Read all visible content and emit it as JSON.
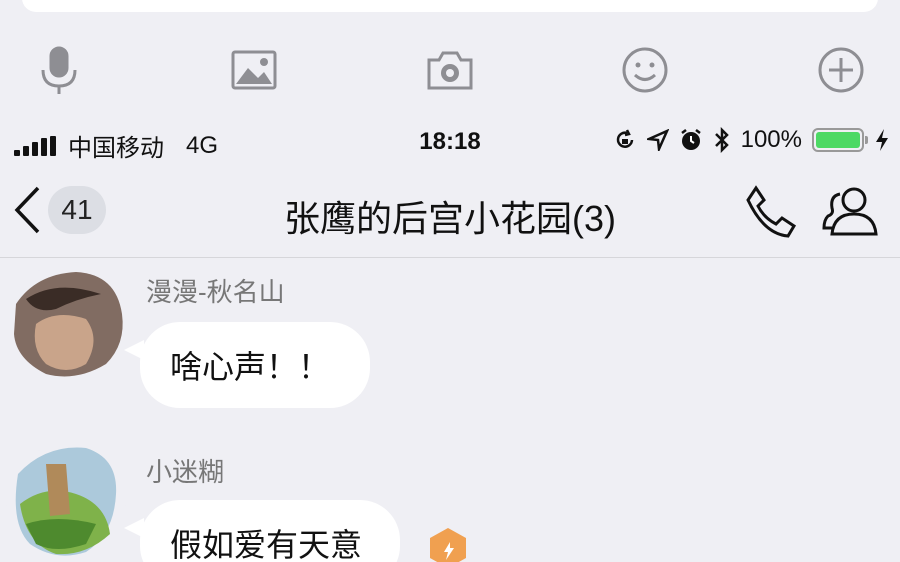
{
  "toolbar": {
    "icons": [
      "microphone-icon",
      "image-icon",
      "camera-icon",
      "emoji-icon",
      "plus-icon"
    ]
  },
  "statusbar": {
    "carrier": "中国移动",
    "network": "4G",
    "time": "18:18",
    "battery_percent": "100%",
    "battery_level": 1.0,
    "icons": [
      "rotation-lock-icon",
      "location-icon",
      "alarm-icon",
      "bluetooth-icon",
      "battery-icon",
      "charging-icon"
    ]
  },
  "navbar": {
    "unread_count": "41",
    "title": "张鹰的后宫小花园(3)"
  },
  "messages": [
    {
      "sender": "漫漫-秋名山",
      "text": "啥心声！！"
    },
    {
      "sender": "小迷糊",
      "text": "假如爱有天意"
    }
  ],
  "colors": {
    "background": "#efeff4",
    "bubble": "#ffffff",
    "icon_gray": "#8e8e93",
    "battery_green": "#4cd964",
    "badge_orange": "#f0a050"
  }
}
